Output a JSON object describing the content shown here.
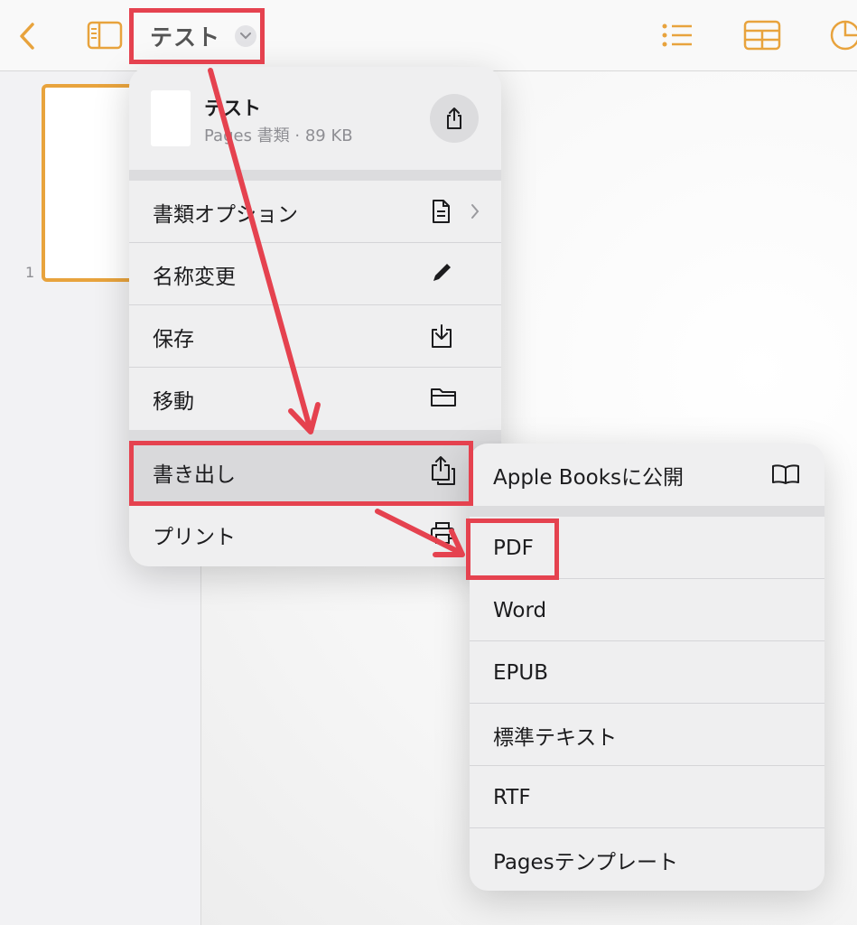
{
  "toolbar": {
    "back_icon": "chevron-left-icon",
    "sidebar_icon": "sidebar-icon",
    "document_title": "テスト",
    "title_menu_icon": "chevron-down-icon",
    "list_icon": "list-icon",
    "table_icon": "table-icon",
    "chart_icon": "pie-chart-icon",
    "accent_color": "#e8a33d"
  },
  "sidebar": {
    "pages": [
      {
        "number": "1"
      }
    ]
  },
  "document_menu": {
    "file_name": "テスト",
    "file_meta": "Pages 書類 · 89 KB",
    "share_icon": "share-icon",
    "items": [
      {
        "label": "書類オプション",
        "icon": "document-icon",
        "has_submenu": true
      },
      {
        "label": "名称変更",
        "icon": "pencil-icon"
      },
      {
        "label": "保存",
        "icon": "save-download-icon"
      },
      {
        "label": "移動",
        "icon": "folder-icon"
      },
      {
        "label": "書き出し",
        "icon": "export-icon",
        "highlighted": true
      },
      {
        "label": "プリント",
        "icon": "printer-icon"
      }
    ]
  },
  "export_submenu": {
    "items": [
      {
        "label": "Apple Booksに公開",
        "icon": "book-icon"
      },
      {
        "label": "PDF",
        "highlighted": true
      },
      {
        "label": "Word"
      },
      {
        "label": "EPUB"
      },
      {
        "label": "標準テキスト"
      },
      {
        "label": "RTF"
      },
      {
        "label": "Pagesテンプレート"
      }
    ]
  },
  "annotation_color": "#e5424f"
}
